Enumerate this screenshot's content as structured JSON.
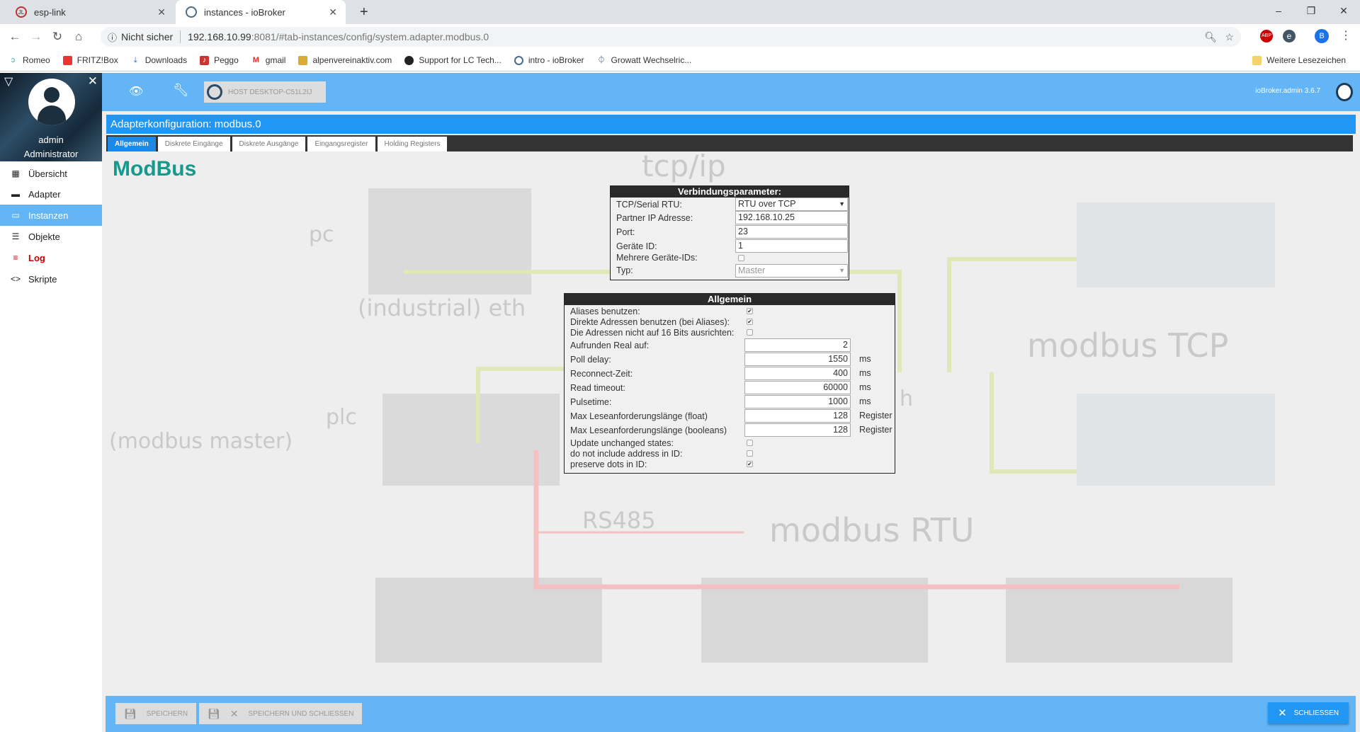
{
  "browser": {
    "tabs": [
      {
        "title": "esp-link",
        "active": false
      },
      {
        "title": "instances - ioBroker",
        "active": true
      }
    ],
    "new_tab": "+",
    "window_controls": [
      "–",
      "❐",
      "✕"
    ],
    "security": "Nicht sicher",
    "url_host": "192.168.10.99",
    "url_rest": ":8081/#tab-instances/config/system.adapter.modbus.0",
    "profile_initial": "B",
    "bookmarks": [
      "Romeo",
      "FRITZ!Box",
      "Downloads",
      "Peggo",
      "gmail",
      "alpenvereinaktiv.com",
      "Support for LC Tech...",
      "intro - ioBroker",
      "Growatt Wechselric..."
    ],
    "more_bookmarks": "Weitere Lesezeichen"
  },
  "sidebar": {
    "user": "admin",
    "role": "Administrator",
    "items": [
      {
        "label": "Übersicht",
        "icon": "grid-icon"
      },
      {
        "label": "Adapter",
        "icon": "store-icon"
      },
      {
        "label": "Instanzen",
        "icon": "instances-icon",
        "active": true
      },
      {
        "label": "Objekte",
        "icon": "list-icon"
      },
      {
        "label": "Log",
        "icon": "log-icon"
      },
      {
        "label": "Skripte",
        "icon": "code-icon"
      }
    ]
  },
  "topbar": {
    "host": "HOST DESKTOP-C51L2IJ",
    "version": "ioBroker.admin 3.6.7"
  },
  "config": {
    "title": "Adapterkonfiguration: modbus.0",
    "tabs": [
      "Allgemein",
      "Diskrete Eingänge",
      "Diskrete Ausgänge",
      "Eingangsregister",
      "Holding Registers"
    ],
    "heading": "ModBus",
    "background_labels": [
      "tcp/ip",
      "pc",
      "(industrial) eth",
      "modbus TCP",
      "plc",
      "(modbus master)",
      "RS485",
      "modbus RTU",
      "h"
    ],
    "connection": {
      "title": "Verbindungsparameter:",
      "mode_label": "TCP/Serial RTU:",
      "mode_value": "RTU over TCP",
      "ip_label": "Partner IP Adresse:",
      "ip_value": "192.168.10.25",
      "port_label": "Port:",
      "port_value": "23",
      "id_label": "Geräte ID:",
      "id_value": "1",
      "multi_label": "Mehrere Geräte-IDs:",
      "multi_checked": false,
      "type_label": "Typ:",
      "type_value": "Master"
    },
    "general": {
      "title": "Allgemein",
      "checks_top": [
        {
          "label": "Aliases benutzen:",
          "checked": true
        },
        {
          "label": "Direkte Adressen benutzen (bei Aliases):",
          "checked": true
        },
        {
          "label": "Die Adressen nicht auf 16 Bits ausrichten:",
          "checked": false
        }
      ],
      "fields": [
        {
          "label": "Aufrunden Real auf:",
          "value": "2",
          "unit": ""
        },
        {
          "label": "Poll delay:",
          "value": "1550",
          "unit": "ms"
        },
        {
          "label": "Reconnect-Zeit:",
          "value": "400",
          "unit": "ms"
        },
        {
          "label": "Read timeout:",
          "value": "60000",
          "unit": "ms"
        },
        {
          "label": "Pulsetime:",
          "value": "1000",
          "unit": "ms"
        },
        {
          "label": "Max Leseanforderungslänge (float)",
          "value": "128",
          "unit": "Register"
        },
        {
          "label": "Max Leseanforderungslänge (booleans)",
          "value": "128",
          "unit": "Register"
        }
      ],
      "checks_bottom": [
        {
          "label": "Update unchanged states:",
          "checked": false
        },
        {
          "label": "do not include address in ID:",
          "checked": false
        },
        {
          "label": "preserve dots in ID:",
          "checked": true
        }
      ]
    }
  },
  "footer": {
    "save": "SPEICHERN",
    "save_close": "SPEICHERN UND SCHLIESSEN",
    "close": "SCHLIESSEN"
  }
}
